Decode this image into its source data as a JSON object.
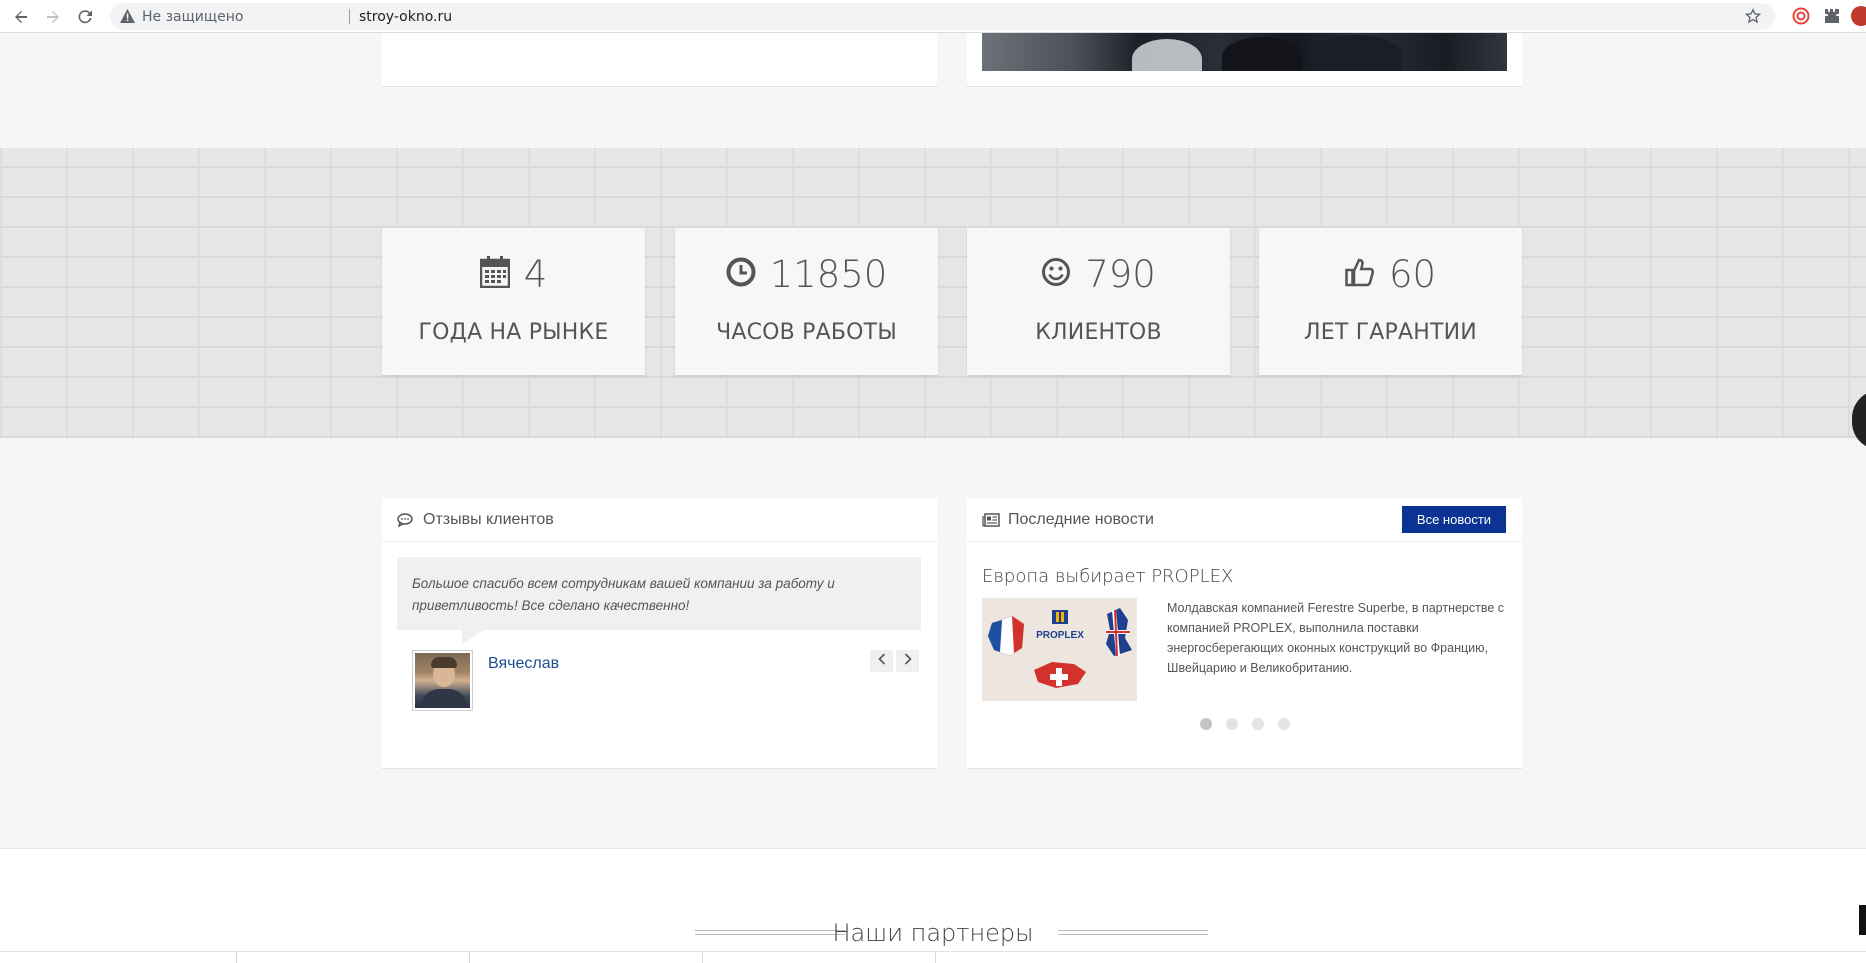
{
  "browser": {
    "security_label": "Не защищено",
    "url": "stroy-okno.ru"
  },
  "stats": [
    {
      "icon": "calendar-icon",
      "value": "4",
      "label": "ГОДА НА РЫНКЕ"
    },
    {
      "icon": "clock-icon",
      "value": "11850",
      "label": "ЧАСОВ РАБОТЫ"
    },
    {
      "icon": "smile-icon",
      "value": "790",
      "label": "КЛИЕНТОВ"
    },
    {
      "icon": "thumbs-up-icon",
      "value": "60",
      "label": "ЛЕТ ГАРАНТИИ"
    }
  ],
  "reviews": {
    "title": "Отзывы клиентов",
    "quote": "Большое спасибо всем сотрудникам вашей компании за работу и приветливость! Все сделано качественно!",
    "author": "Вячеслав",
    "prev_label": "‹",
    "next_label": "›"
  },
  "news": {
    "title": "Последние новости",
    "all_label": "Все новости",
    "headline": "Европа выбирает PROPLEX",
    "body": "Молдавская компанией Ferestre Superbe, в партнерстве с компанией PROPLEX, выполнила поставки энергосберегающих оконных конструкций во Францию, Швейцарию и Великобританию.",
    "image_brand": "PROPLEX",
    "dots": 4,
    "active_dot": 0
  },
  "partners": {
    "title": "Наши партнеры"
  },
  "colors": {
    "accent": "#0a3393",
    "author_link": "#1d4d93"
  }
}
